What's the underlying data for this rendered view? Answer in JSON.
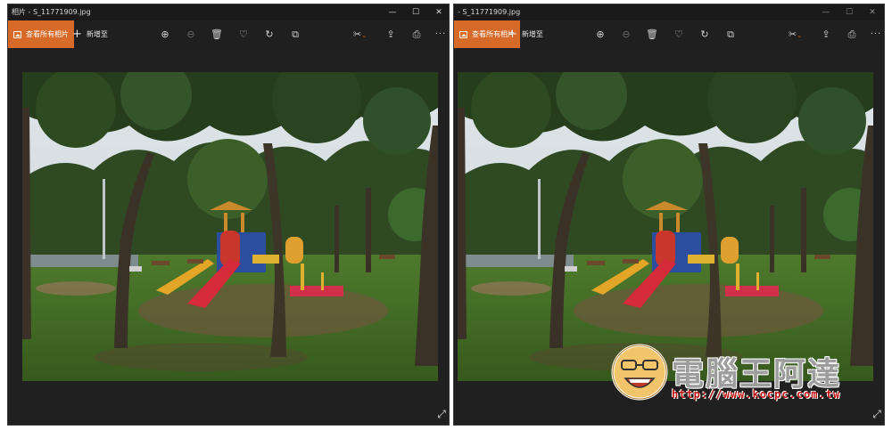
{
  "windows": [
    {
      "title": "相片 - S_11771909.jpg",
      "view_all_label": "查看所有相片",
      "add_to_label": "新增至"
    },
    {
      "title": "- S_11771909.jpg",
      "view_all_label": "查看所有相片",
      "add_to_label": "新增至"
    }
  ],
  "window_controls": {
    "minimize": "—",
    "maximize": "☐",
    "close": "✕"
  },
  "toolbar_icons": {
    "zoom_in": "⊕",
    "zoom_out": "⊖",
    "delete": "🗑",
    "favorite": "♡",
    "rotate": "↻",
    "crop": "⧉",
    "edit": "✂",
    "share": "⇪",
    "print": "⎙",
    "more": "···"
  },
  "expand_icon": "⤢",
  "colors": {
    "accent": "#d76a28",
    "window_bg": "#202020",
    "titlebar_bg": "#1a1a1a"
  },
  "watermark": {
    "title": "電腦王阿達",
    "url": "http://www.kocpc.com.tw"
  }
}
